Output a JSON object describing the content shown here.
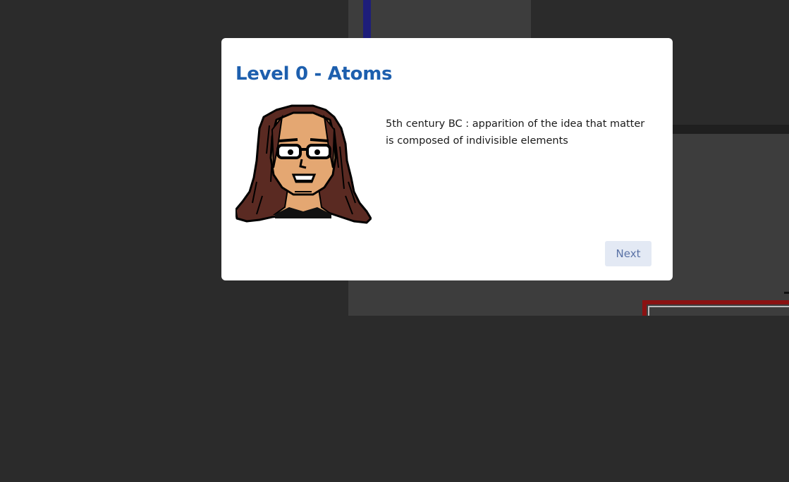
{
  "dialog": {
    "title": "Level 0 - Atoms",
    "text": "5th century BC : apparition of the idea that matter is composed of indivisible elements",
    "next_label": "Next",
    "portrait_icon": "scientist-portrait-icon"
  },
  "colors": {
    "title": "#1d5fae",
    "background": "#2b2b2b",
    "panel": "#3d3d3d",
    "button_bg": "#e3e9f4",
    "button_text": "#5a72a6",
    "hair": "#5a2a22",
    "skin": "#e4a772"
  }
}
